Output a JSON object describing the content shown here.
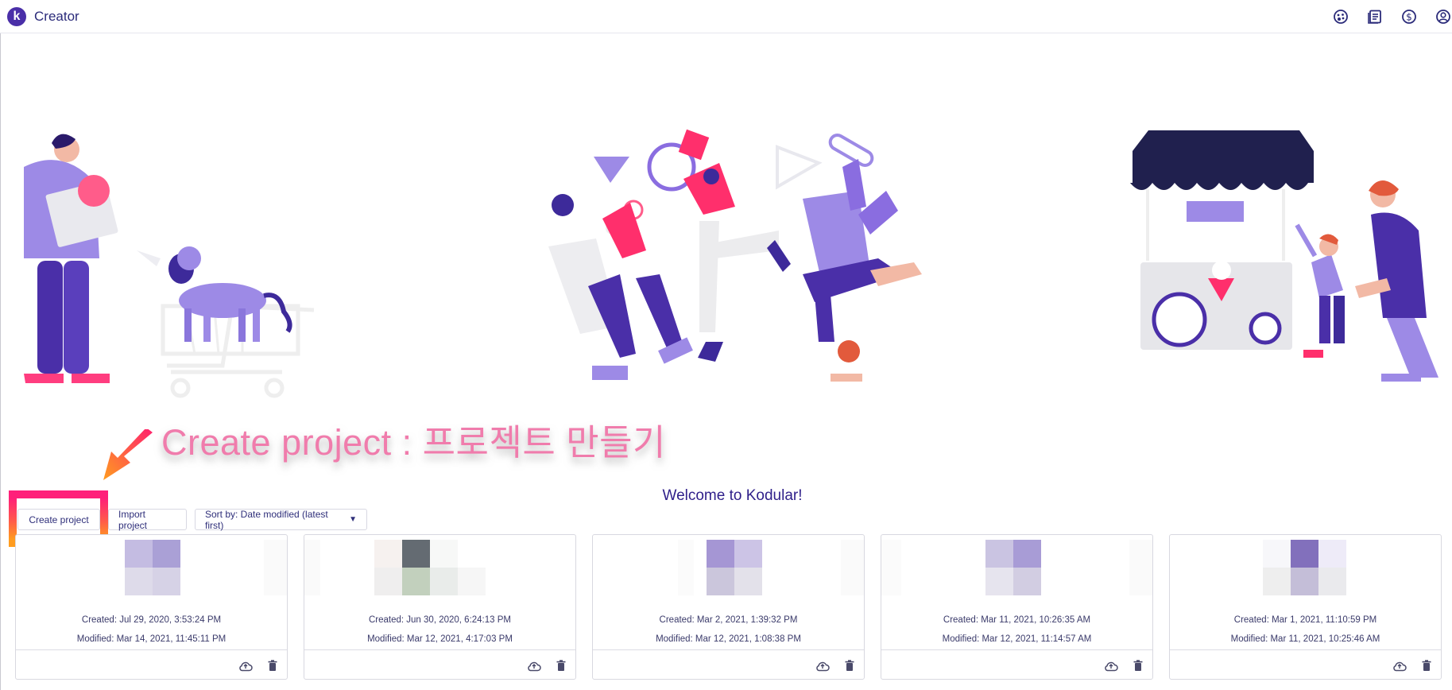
{
  "app": {
    "title": "Creator",
    "logo_letter": "k",
    "accent": "#4a2fa8"
  },
  "top_icons": [
    "palette-icon",
    "docs-icon",
    "dollar-icon",
    "account-icon"
  ],
  "annotation": {
    "text": "Create project : 프로젝트 만들기",
    "text_color": "#f07cac",
    "box_colors": [
      "#ff1f7a",
      "#ff9d1f"
    ]
  },
  "welcome": "Welcome to Kodular!",
  "toolbar": {
    "create_label": "Create project",
    "import_label": "Import project",
    "sort_label": "Sort by: Date modified (latest first)"
  },
  "projects": [
    {
      "created": "Created: Jul 29, 2020, 3:53:24 PM",
      "modified": "Modified: Mar 14, 2021, 11:45:11 PM"
    },
    {
      "created": "Created: Jun 30, 2020, 6:24:13 PM",
      "modified": "Modified: Mar 12, 2021, 4:17:03 PM"
    },
    {
      "created": "Created: Mar 2, 2021, 1:39:32 PM",
      "modified": "Modified: Mar 12, 2021, 1:08:38 PM"
    },
    {
      "created": "Created: Mar 11, 2021, 10:26:35 AM",
      "modified": "Modified: Mar 12, 2021, 11:14:57 AM"
    },
    {
      "created": "Created: Mar 1, 2021, 11:10:59 PM",
      "modified": "Modified: Mar 11, 2021, 10:25:46 AM"
    }
  ]
}
